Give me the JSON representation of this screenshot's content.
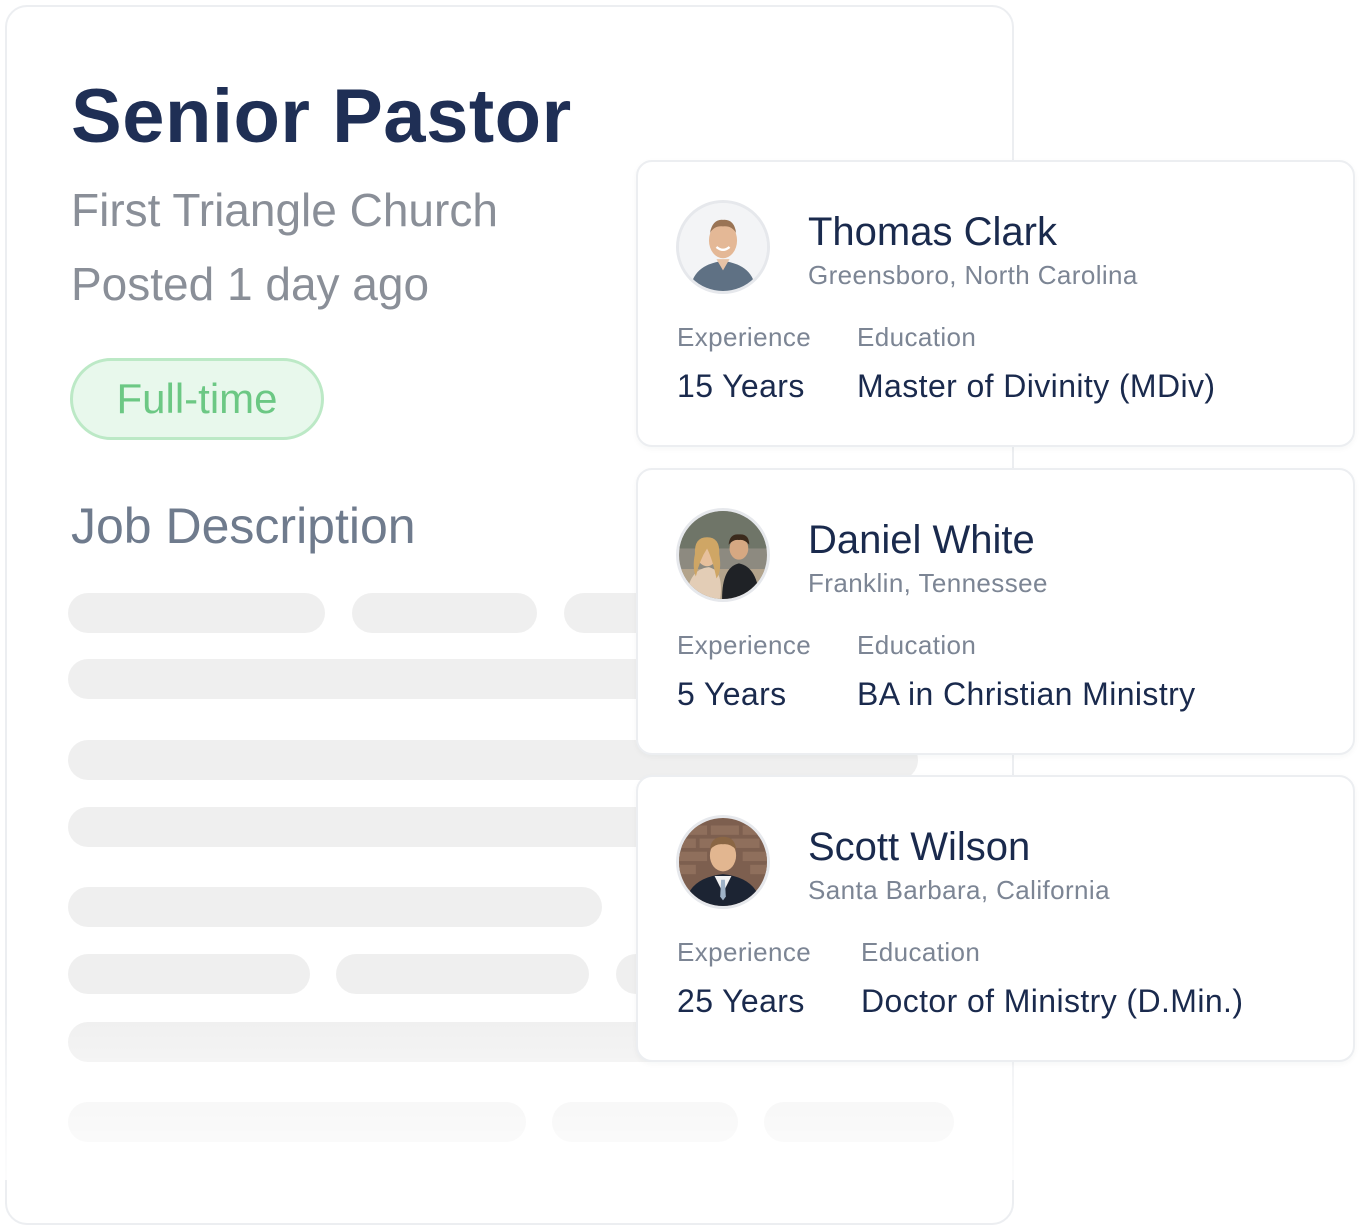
{
  "job": {
    "title": "Senior Pastor",
    "church": "First Triangle Church",
    "posted": "Posted 1 day ago",
    "type": "Full-time",
    "description_heading": "Job Description"
  },
  "candidates": [
    {
      "name": "Thomas Clark",
      "location": "Greensboro, North Carolina",
      "experience_label": "Experience",
      "experience": "15 Years",
      "education_label": "Education",
      "education": "Master of Divinity (MDiv)"
    },
    {
      "name": "Daniel White",
      "location": "Franklin, Tennessee",
      "experience_label": "Experience",
      "experience": "5 Years",
      "education_label": "Education",
      "education": "BA in Christian Ministry"
    },
    {
      "name": "Scott Wilson",
      "location": "Santa Barbara, California",
      "experience_label": "Experience",
      "experience": "25 Years",
      "education_label": "Education",
      "education": "Doctor of Ministry (D.Min.)"
    }
  ],
  "colors": {
    "title": "#1f2f55",
    "muted": "#8a8f98",
    "badge_bg": "#e8f8ec",
    "badge_border": "#bce9c6",
    "badge_text": "#6cc884",
    "skeleton": "#efefef"
  }
}
